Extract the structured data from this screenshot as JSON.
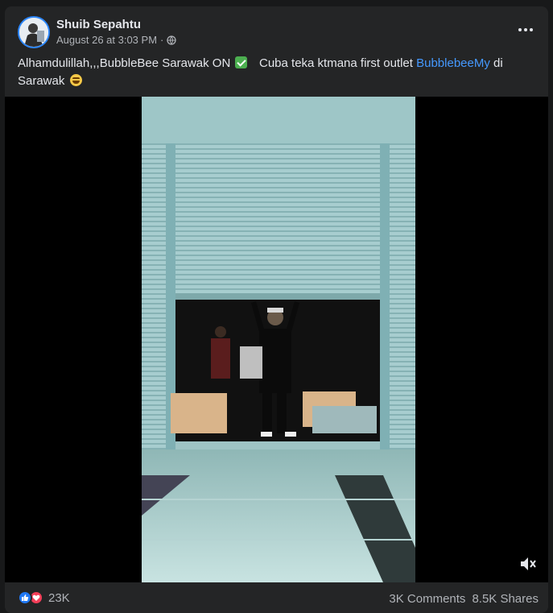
{
  "post": {
    "author": "Shuib Sepahtu",
    "timestamp": "August 26 at 3:03 PM",
    "privacy_separator": "·",
    "privacy_icon": "globe-icon",
    "caption": {
      "part1": "Alhamdulillah,,,BubbleBee Sarawak ON",
      "part2": "Cuba teka ktmana first outlet",
      "link": "BubblebeeMy",
      "part3": "di Sarawak"
    }
  },
  "video": {
    "muted": true,
    "mute_icon": "speaker-muted-icon"
  },
  "footer": {
    "reaction_count": "23K",
    "comments": "3K Comments",
    "shares": "8.5K Shares"
  },
  "colors": {
    "background": "#18191a",
    "card": "#242526",
    "text": "#e4e6eb",
    "secondary_text": "#b0b3b8",
    "link": "#4599ff",
    "like": "#2078f4",
    "love": "#f33e58"
  }
}
